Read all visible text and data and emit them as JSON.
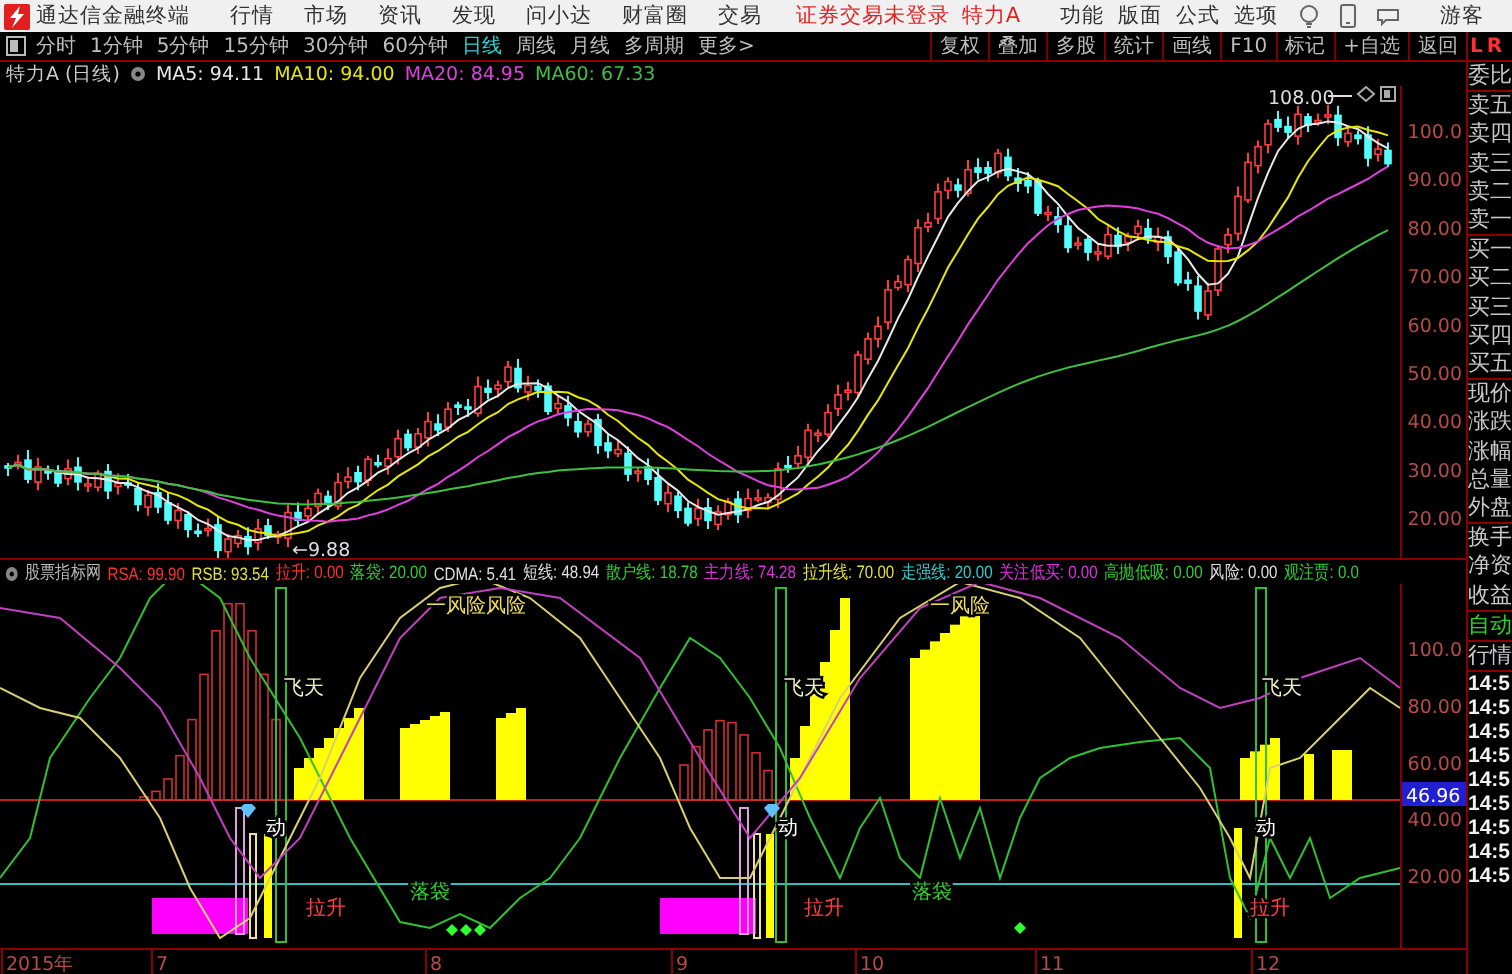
{
  "menu_bar": {
    "app_title": "通达信金融终端",
    "menus": [
      "行情",
      "市场",
      "资讯",
      "发现",
      "问小达",
      "财富圈",
      "交易"
    ],
    "login_status": "证券交易未登录",
    "stock": "特力A",
    "actions": [
      "功能",
      "版面",
      "公式",
      "选项"
    ],
    "user": "游客"
  },
  "period_bar": {
    "periods": [
      {
        "label": "分时",
        "selected": false
      },
      {
        "label": "1分钟",
        "selected": false
      },
      {
        "label": "5分钟",
        "selected": false
      },
      {
        "label": "15分钟",
        "selected": false
      },
      {
        "label": "30分钟",
        "selected": false
      },
      {
        "label": "60分钟",
        "selected": false
      },
      {
        "label": "日线",
        "selected": true
      },
      {
        "label": "周线",
        "selected": false
      },
      {
        "label": "月线",
        "selected": false
      },
      {
        "label": "多周期",
        "selected": false
      },
      {
        "label": "更多>",
        "selected": false
      }
    ],
    "tools": [
      "复权",
      "叠加",
      "多股",
      "统计",
      "画线",
      "F10",
      "标记",
      "+自选",
      "返回"
    ]
  },
  "price_chart": {
    "title": "特力A (日线)",
    "moving_averages": [
      {
        "label": "MA5: 94.11",
        "color": "#e8e8e8"
      },
      {
        "label": "MA10: 94.00",
        "color": "#e8e800"
      },
      {
        "label": "MA20: 84.95",
        "color": "#e040e0"
      },
      {
        "label": "MA60: 67.33",
        "color": "#40c040"
      }
    ],
    "high_label": "108.00",
    "low_label": "←9.88",
    "axis_labels": [
      "100.0",
      "90.00",
      "80.00",
      "70.00",
      "60.00",
      "50.00",
      "40.00",
      "30.00",
      "20.00"
    ]
  },
  "indicator": {
    "name": "股票指标网",
    "readings": [
      {
        "label": "RSA: 99.90",
        "color": "#ff3030"
      },
      {
        "label": "RSB: 93.54",
        "color": "#e0e040"
      },
      {
        "label": "拉升: 0.00",
        "color": "#ff3030"
      },
      {
        "label": "落袋: 20.00",
        "color": "#30d030"
      },
      {
        "label": "CDMA: 5.41",
        "color": "#e0e0e0"
      },
      {
        "label": "短线: 48.94",
        "color": "#e0e0e0"
      },
      {
        "label": "散户线: 18.78",
        "color": "#30d030"
      },
      {
        "label": "主力线: 74.28",
        "color": "#e030e0"
      },
      {
        "label": "拉升线: 70.00",
        "color": "#e0e040"
      },
      {
        "label": "走强线: 20.00",
        "color": "#30d0d0"
      },
      {
        "label": "关注低买: 0.00",
        "color": "#e030e0"
      },
      {
        "label": "高抛低吸: 0.00",
        "color": "#30d030"
      },
      {
        "label": "风险: 0.00",
        "color": "#e0e0e0"
      },
      {
        "label": "观注贾: 0.0",
        "color": "#30d030"
      }
    ],
    "signal_labels": [
      "一风险风险",
      "一风险",
      "飞天",
      "飞天",
      "飞天",
      "动",
      "动",
      "动",
      "拉升",
      "拉升",
      "拉升",
      "落袋",
      "落袋"
    ],
    "axis_labels": [
      "100.0",
      "80.00",
      "60.00",
      "40.00",
      "20.00"
    ],
    "current_value": "46.96"
  },
  "time_axis": [
    "2015年",
    "7",
    "8",
    "9",
    "10",
    "11",
    "12"
  ],
  "quote_panel": {
    "header": [
      "L",
      "R"
    ],
    "sections": [
      {
        "kind": "quote",
        "items": [
          "委比"
        ]
      },
      {
        "kind": "quote",
        "items": [
          "卖五",
          "卖四",
          "卖三",
          "卖二",
          "卖一"
        ]
      },
      {
        "kind": "quote",
        "items": [
          "买一",
          "买二",
          "买三",
          "买四",
          "买五"
        ]
      },
      {
        "kind": "quote",
        "items": [
          "现价",
          "涨跌",
          "涨幅",
          "总量",
          "外盘"
        ]
      },
      {
        "kind": "quote",
        "items": [
          "换手",
          "净资",
          "收益"
        ]
      },
      {
        "kind": "mode",
        "items": [
          "自动"
        ]
      },
      {
        "kind": "tab",
        "items": [
          "行情"
        ]
      },
      {
        "kind": "ticks",
        "items": [
          "14:5",
          "14:5",
          "14:5",
          "14:5",
          "14:5",
          "14:5",
          "14:5",
          "14:5",
          "14:5"
        ]
      }
    ]
  }
}
